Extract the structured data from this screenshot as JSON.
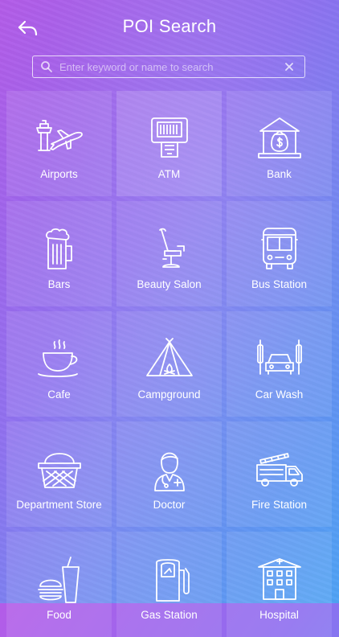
{
  "header": {
    "title": "POI Search",
    "back_icon": "back-arrow-icon"
  },
  "search": {
    "placeholder": "Enter keyword or name to search",
    "value": ""
  },
  "categories": [
    {
      "label": "Airports",
      "icon": "airport-icon"
    },
    {
      "label": "ATM",
      "icon": "atm-icon"
    },
    {
      "label": "Bank",
      "icon": "bank-icon"
    },
    {
      "label": "Bars",
      "icon": "beer-icon"
    },
    {
      "label": "Beauty Salon",
      "icon": "salon-chair-icon"
    },
    {
      "label": "Bus Station",
      "icon": "bus-icon"
    },
    {
      "label": "Cafe",
      "icon": "coffee-cup-icon"
    },
    {
      "label": "Campground",
      "icon": "tent-icon"
    },
    {
      "label": "Car Wash",
      "icon": "car-wash-icon"
    },
    {
      "label": "Department Store",
      "icon": "basket-icon"
    },
    {
      "label": "Doctor",
      "icon": "doctor-icon"
    },
    {
      "label": "Fire Station",
      "icon": "fire-truck-icon"
    },
    {
      "label": "Food",
      "icon": "food-icon"
    },
    {
      "label": "Gas Station",
      "icon": "gas-pump-icon"
    },
    {
      "label": "Hospital",
      "icon": "hospital-icon"
    }
  ]
}
